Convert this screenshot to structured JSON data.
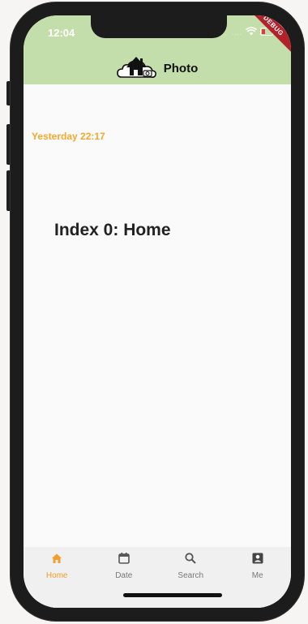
{
  "status_bar": {
    "time": "12:04",
    "dots": "....",
    "debug_banner": "DEBUG",
    "icons": [
      "wifi-icon",
      "battery-icon"
    ]
  },
  "app_bar": {
    "title": "Photo",
    "logo_icon": "house-cloud-photo-icon",
    "background_color": "#c4deab"
  },
  "main": {
    "timestamp": "Yesterday 22:17",
    "index_text": "Index 0: Home",
    "accent_color": "#f4a92e"
  },
  "bottom_nav": {
    "active_index": 0,
    "items": [
      {
        "label": "Home",
        "icon": "home-icon"
      },
      {
        "label": "Date",
        "icon": "calendar-icon"
      },
      {
        "label": "Search",
        "icon": "search-icon"
      },
      {
        "label": "Me",
        "icon": "person-icon"
      }
    ]
  }
}
